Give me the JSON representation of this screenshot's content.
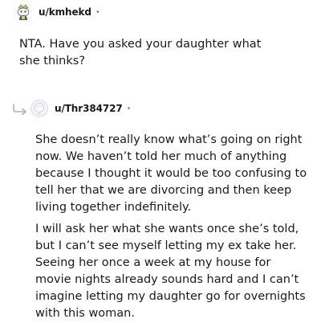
{
  "comments": [
    {
      "username": "u/kmhekd",
      "separator": "•",
      "paragraphs": [
        "NTA. Have you asked your daughter what she thinks?"
      ]
    },
    {
      "username": "u/Thr384727",
      "separator": "•",
      "paragraphs": [
        "She doesn’t really know what’s going on right now. We haven’t told her much of anything because I thought it would be too confusing to tell her that we are divorcing and then keep living together indefinitely.",
        "I will ask her what she wants once she’s told, but I can’t see myself letting my ex take her. Seeing her once a week at my house for movie nights already sounds hard and I can’t imagine letting my daughter go for overnights with this woman."
      ]
    }
  ],
  "icons": {
    "avatar_1": "snoo-avatar-icon",
    "avatar_2": "default-avatar-icon",
    "reply": "reply-arrow-icon"
  },
  "colors": {
    "text": "#1a1a1b",
    "meta": "#878a8c",
    "reply_arrow": "#a8b3bd"
  }
}
